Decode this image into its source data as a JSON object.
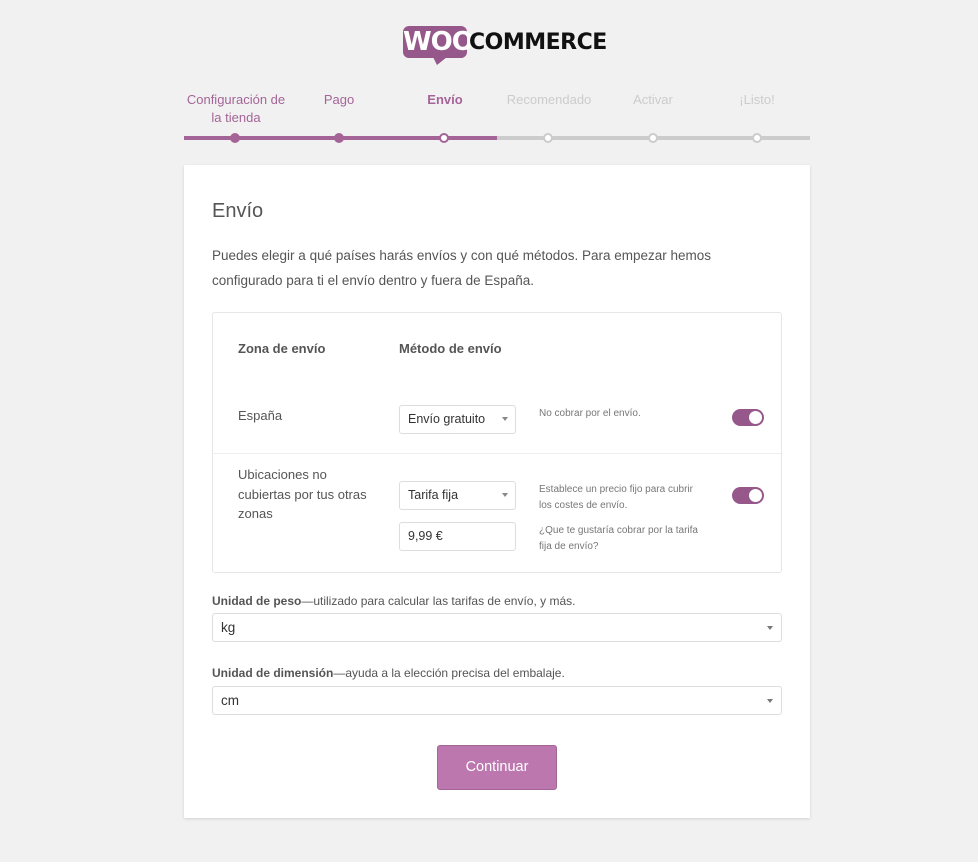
{
  "logo": {
    "woo": "WOO",
    "commerce": "COMMERCE"
  },
  "steps": [
    {
      "label": "Configuración de la tienda",
      "state": "done"
    },
    {
      "label": "Pago",
      "state": "done"
    },
    {
      "label": "Envío",
      "state": "active"
    },
    {
      "label": "Recomendado",
      "state": "todo"
    },
    {
      "label": "Activar",
      "state": "todo"
    },
    {
      "label": "¡Listo!",
      "state": "todo"
    }
  ],
  "card": {
    "title": "Envío",
    "intro": "Puedes elegir a qué países harás envíos y con qué métodos. Para empezar hemos configurado para ti el envío dentro y fuera de España."
  },
  "zones": {
    "headers": {
      "zone": "Zona de envío",
      "method": "Método de envío"
    },
    "rows": [
      {
        "zone": "España",
        "method": "Envío gratuito",
        "description": "No cobrar por el envío.",
        "enabled": true
      },
      {
        "zone": "Ubicaciones no cubiertas por tus otras zonas",
        "method": "Tarifa fija",
        "description": "Establece un precio fijo para cubrir los costes de envío.",
        "price_value": "9,99 €",
        "price_description": "¿Que te gustaría cobrar por la tarifa fija de envío?",
        "enabled": true
      }
    ]
  },
  "weight": {
    "label_bold": "Unidad de peso",
    "label_rest": "—utilizado para calcular las tarifas de envío, y más.",
    "value": "kg"
  },
  "dimension": {
    "label_bold": "Unidad de dimensión",
    "label_rest": "—ayuda a la elección precisa del embalaje.",
    "value": "cm"
  },
  "continue_label": "Continuar",
  "colors": {
    "brand": "#96588a",
    "button": "#bb77ae",
    "inactive": "#cccccc"
  }
}
